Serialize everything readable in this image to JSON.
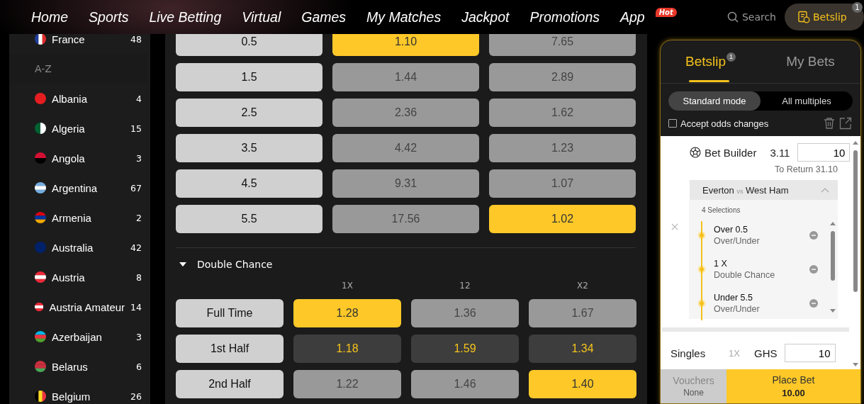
{
  "nav": {
    "items": [
      {
        "label": "Home"
      },
      {
        "label": "Sports"
      },
      {
        "label": "Live Betting"
      },
      {
        "label": "Virtual"
      },
      {
        "label": "Games"
      },
      {
        "label": "My Matches"
      },
      {
        "label": "Jackpot"
      },
      {
        "label": "Promotions"
      },
      {
        "label": "App",
        "badge": "Hot"
      }
    ],
    "search": "Search",
    "betslip_button": {
      "label": "Betslip",
      "count": "1"
    }
  },
  "sidebar": {
    "top_item": {
      "name": "France",
      "count": "48"
    },
    "section": "A-Z",
    "items": [
      {
        "name": "Albania",
        "count": "4"
      },
      {
        "name": "Algeria",
        "count": "15"
      },
      {
        "name": "Angola",
        "count": "3"
      },
      {
        "name": "Argentina",
        "count": "67"
      },
      {
        "name": "Armenia",
        "count": "2"
      },
      {
        "name": "Australia",
        "count": "42"
      },
      {
        "name": "Austria",
        "count": "8"
      },
      {
        "name": "Austria Amateur",
        "count": "14"
      },
      {
        "name": "Azerbaijan",
        "count": "3"
      },
      {
        "name": "Belarus",
        "count": "6"
      },
      {
        "name": "Belgium",
        "count": "26"
      }
    ]
  },
  "over_under": {
    "rows": [
      {
        "line": "0.5",
        "odds": [
          {
            "value": "1.10",
            "selected": true
          },
          {
            "value": "7.65",
            "selected": false
          }
        ]
      },
      {
        "line": "1.5",
        "odds": [
          {
            "value": "1.44",
            "selected": false
          },
          {
            "value": "2.89",
            "selected": false
          }
        ]
      },
      {
        "line": "2.5",
        "odds": [
          {
            "value": "2.36",
            "selected": false
          },
          {
            "value": "1.62",
            "selected": false
          }
        ]
      },
      {
        "line": "3.5",
        "odds": [
          {
            "value": "4.42",
            "selected": false
          },
          {
            "value": "1.23",
            "selected": false
          }
        ]
      },
      {
        "line": "4.5",
        "odds": [
          {
            "value": "9.31",
            "selected": false
          },
          {
            "value": "1.07",
            "selected": false
          }
        ]
      },
      {
        "line": "5.5",
        "odds": [
          {
            "value": "17.56",
            "selected": false
          },
          {
            "value": "1.02",
            "selected": true
          }
        ]
      }
    ]
  },
  "double_chance": {
    "title": "Double Chance",
    "expanded": true,
    "columns": [
      "1X",
      "12",
      "X2"
    ],
    "rows": [
      {
        "label": "Full Time",
        "kind": "normal",
        "odds": [
          {
            "value": "1.28",
            "selected": true
          },
          {
            "value": "1.36",
            "selected": false
          },
          {
            "value": "1.67",
            "selected": false
          }
        ]
      },
      {
        "label": "1st Half",
        "kind": "dark",
        "odds": [
          {
            "value": "1.18",
            "selected": false
          },
          {
            "value": "1.59",
            "selected": false
          },
          {
            "value": "1.34",
            "selected": false
          }
        ]
      },
      {
        "label": "2nd Half",
        "kind": "normal",
        "odds": [
          {
            "value": "1.22",
            "selected": false
          },
          {
            "value": "1.46",
            "selected": false
          },
          {
            "value": "1.40",
            "selected": true
          }
        ]
      }
    ]
  },
  "betslip": {
    "tabs": [
      {
        "label": "Betslip",
        "badge": "1",
        "selected": true
      },
      {
        "label": "My Bets",
        "selected": false
      }
    ],
    "modes": [
      {
        "label": "Standard mode",
        "selected": true
      },
      {
        "label": "All multiples",
        "selected": false
      }
    ],
    "accept_odds": {
      "label": "Accept odds changes",
      "checked": false
    },
    "bet": {
      "title": "Bet Builder",
      "odds": "3.11",
      "stake": "10",
      "to_return": "To Return 31.10",
      "home": "Everton",
      "vs": "vs",
      "away": "West Ham",
      "count": "4 Selections",
      "selections": [
        {
          "pick": "Over 0.5",
          "market": "Over/Under"
        },
        {
          "pick": "1 X",
          "market": "Double Chance"
        },
        {
          "pick": "Under 5.5",
          "market": "Over/Under"
        }
      ]
    },
    "singles": {
      "label": "Singles",
      "multiplier": "1X",
      "currency": "GHS",
      "stake": "10"
    },
    "vouchers": {
      "label": "Vouchers",
      "value": "None"
    },
    "place_bet": {
      "label": "Place Bet",
      "amount": "10.00"
    }
  }
}
